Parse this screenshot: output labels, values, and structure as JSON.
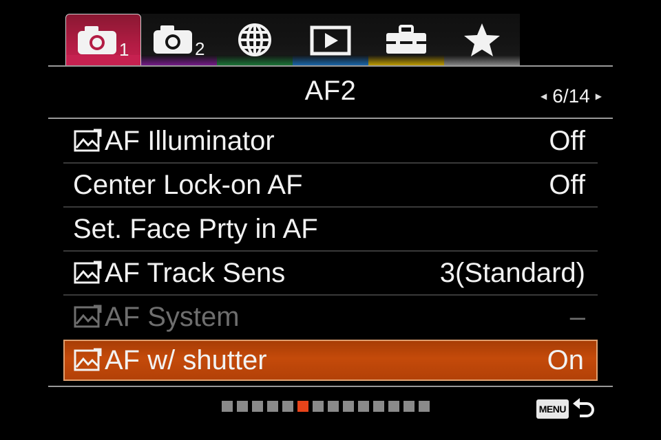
{
  "tabs": [
    {
      "icon": "camera-1-icon",
      "number": "1",
      "stripe_color": "#c62150",
      "active": true
    },
    {
      "icon": "camera-2-icon",
      "number": "2",
      "stripe_color": "#7a1b8f"
    },
    {
      "icon": "globe-icon",
      "stripe_color": "#1c7a3a"
    },
    {
      "icon": "playback-icon",
      "stripe_color": "#1a6bb3"
    },
    {
      "icon": "toolbox-icon",
      "stripe_color": "#c9a300"
    },
    {
      "icon": "star-icon",
      "stripe_color": "#8a8a8a"
    }
  ],
  "page": {
    "title": "AF2",
    "pager": "6/14"
  },
  "items": [
    {
      "label": "AF Illuminator",
      "value": "Off",
      "icon": "image-settings-icon"
    },
    {
      "label": "Center Lock-on AF",
      "value": "Off"
    },
    {
      "label": "Set. Face Prty in AF",
      "value": ""
    },
    {
      "label": "AF Track Sens",
      "value": "3(Standard)",
      "icon": "image-settings-icon"
    },
    {
      "label": "AF System",
      "value": "–",
      "icon": "image-settings-icon",
      "disabled": true
    },
    {
      "label": "AF w/ shutter",
      "value": "On",
      "icon": "image-settings-icon",
      "selected": true
    }
  ],
  "page_indicator": {
    "total": 14,
    "current": 6
  },
  "footer": {
    "menu_label": "MENU",
    "back_icon": "return-icon"
  },
  "colors": {
    "selection": "#c44a0a",
    "active_dot": "#e8441a"
  }
}
